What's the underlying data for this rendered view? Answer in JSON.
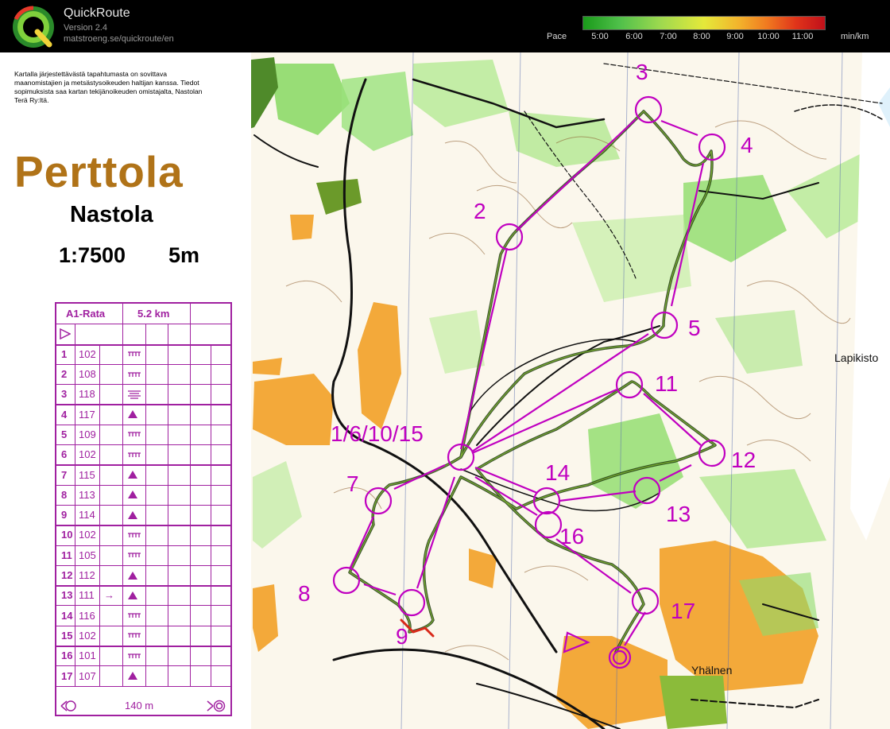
{
  "header": {
    "app_name": "QuickRoute",
    "version": "Version 2.4",
    "url": "matstroeng.se/quickroute/en",
    "pace_label": "Pace",
    "pace_ticks": [
      "5:00",
      "6:00",
      "7:00",
      "8:00",
      "9:00",
      "10:00",
      "11:00"
    ],
    "pace_unit": "min/km",
    "pace_colors": [
      "#1a9a1a",
      "#4fc04a",
      "#9ed94f",
      "#e5e93a",
      "#f2b52c",
      "#f07a20",
      "#e0341a",
      "#c0101a"
    ]
  },
  "map_header": {
    "note": "Kartalla järjestettävästä tapahtumasta on sovittava maanomistajien ja metsästysoikeuden haltijan kanssa. Tiedot sopimuksista saa kartan tekijänoikeuden omistajalta, Nastolan Terä Ry:ltä.",
    "title": "Perttola",
    "place": "Nastola",
    "scale": "1:7500",
    "contour": "5m"
  },
  "control_description": {
    "course": "A1-Rata",
    "length": "5.2 km",
    "controls": [
      {
        "num": "1",
        "code": "102",
        "symbol": "cliff-icon",
        "arrow": ""
      },
      {
        "num": "2",
        "code": "108",
        "symbol": "cliff-icon",
        "arrow": ""
      },
      {
        "num": "3",
        "code": "118",
        "symbol": "marsh-icon",
        "arrow": ""
      },
      {
        "num": "4",
        "code": "117",
        "symbol": "knoll-icon",
        "arrow": ""
      },
      {
        "num": "5",
        "code": "109",
        "symbol": "cliff-icon",
        "arrow": ""
      },
      {
        "num": "6",
        "code": "102",
        "symbol": "cliff-icon",
        "arrow": ""
      },
      {
        "num": "7",
        "code": "115",
        "symbol": "knoll-icon",
        "arrow": ""
      },
      {
        "num": "8",
        "code": "113",
        "symbol": "knoll-icon",
        "arrow": ""
      },
      {
        "num": "9",
        "code": "114",
        "symbol": "knoll-icon",
        "arrow": ""
      },
      {
        "num": "10",
        "code": "102",
        "symbol": "cliff-icon",
        "arrow": ""
      },
      {
        "num": "11",
        "code": "105",
        "symbol": "cliff-icon",
        "arrow": ""
      },
      {
        "num": "12",
        "code": "112",
        "symbol": "knoll-icon",
        "arrow": ""
      },
      {
        "num": "13",
        "code": "111",
        "symbol": "knoll-icon",
        "arrow": "→"
      },
      {
        "num": "14",
        "code": "116",
        "symbol": "cliff-icon",
        "arrow": ""
      },
      {
        "num": "15",
        "code": "102",
        "symbol": "cliff-icon",
        "arrow": ""
      },
      {
        "num": "16",
        "code": "101",
        "symbol": "cliff-icon",
        "arrow": ""
      },
      {
        "num": "17",
        "code": "107",
        "symbol": "knoll-icon",
        "arrow": ""
      }
    ],
    "finish_distance": "140 m"
  },
  "map": {
    "control_labels": [
      "1/6/10/15",
      "2",
      "3",
      "4",
      "5",
      "7",
      "8",
      "9",
      "11",
      "12",
      "13",
      "14",
      "16",
      "17"
    ],
    "place_names": [
      "Lapikisto",
      "Yhälnen"
    ],
    "course_color": "#c000c0"
  }
}
